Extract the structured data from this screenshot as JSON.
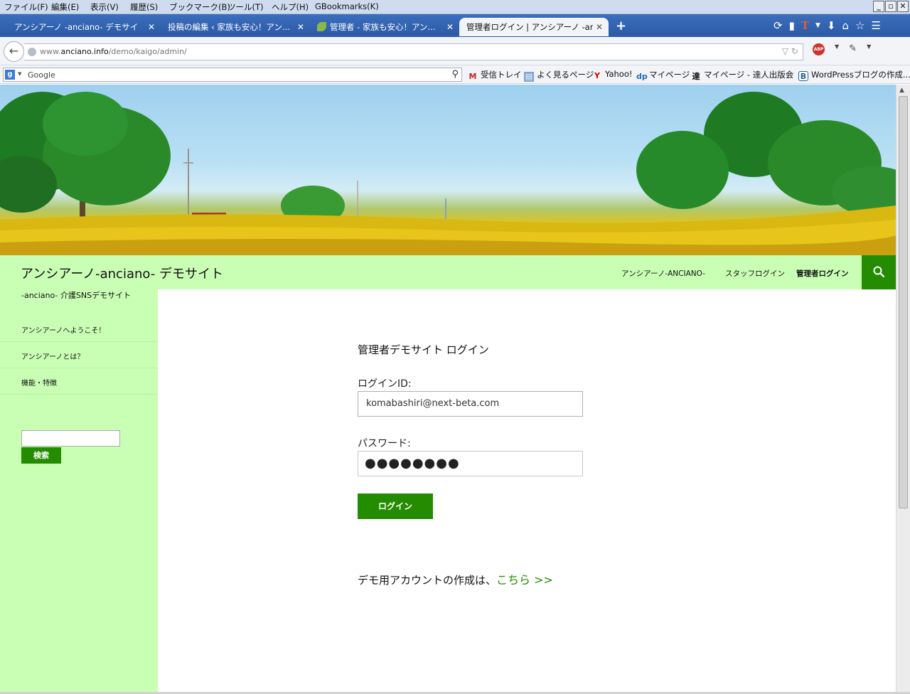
{
  "menubar": {
    "items": [
      "ファイル(F)",
      "編集(E)",
      "表示(V)",
      "履歴(S)",
      "ブックマーク(B)",
      "ツール(T)",
      "ヘルプ(H)",
      "GBookmarks(K)"
    ],
    "window_buttons": [
      "_",
      "▫",
      "✕"
    ]
  },
  "tabs": [
    {
      "label": "アンシアーノ -anciano- デモサイト..."
    },
    {
      "label": "投稿の編集 ‹ 家族も安心！アン..."
    },
    {
      "label": "管理者 - 家族も安心！アン..."
    },
    {
      "label": "管理者ログイン | アンシアーノ -anc..."
    }
  ],
  "tab_close_glyph": "✕",
  "new_tab_glyph": "+",
  "toolbar_icons": [
    "sync-icon",
    "bookmarks-icon",
    "t-icon",
    "download-icon",
    "home-icon",
    "star-icon",
    "menu-icon"
  ],
  "address_bar": {
    "url_prefix": "www.",
    "url_domain": "anciano.info",
    "url_path": "/demo/kaigo/admin/"
  },
  "search_box": {
    "engine": "Google"
  },
  "bookmarks": [
    "受信トレイ",
    "よく見るページ",
    "Yahoo!",
    "マイページ",
    "マイページ - 達人出版会",
    "WordPressブログの作成..."
  ],
  "site": {
    "title": "アンシアーノ-anciano- デモサイト",
    "description": "-anciano- 介護SNSデモサイト",
    "nav": [
      "アンシアーノ-ANCIANO-",
      "スタッフログイン",
      "管理者ログイン"
    ]
  },
  "sidebar": {
    "links": [
      "アンシアーノへようこそ！",
      "アンシアーノとは？",
      "機能・特徴"
    ],
    "search_button": "検索"
  },
  "login": {
    "title": "管理者デモサイト ログイン",
    "id_label": "ログインID:",
    "id_value": "komabashiri@next-beta.com",
    "password_label": "パスワード:",
    "password_value": "●●●●●●●●",
    "submit_label": "ログイン"
  },
  "demo_account": {
    "text": "デモ用アカウントの作成は、",
    "link_text": "こちら >>"
  },
  "colors": {
    "accent_green": "#238c00",
    "header_bg": "#c9ffb4"
  }
}
